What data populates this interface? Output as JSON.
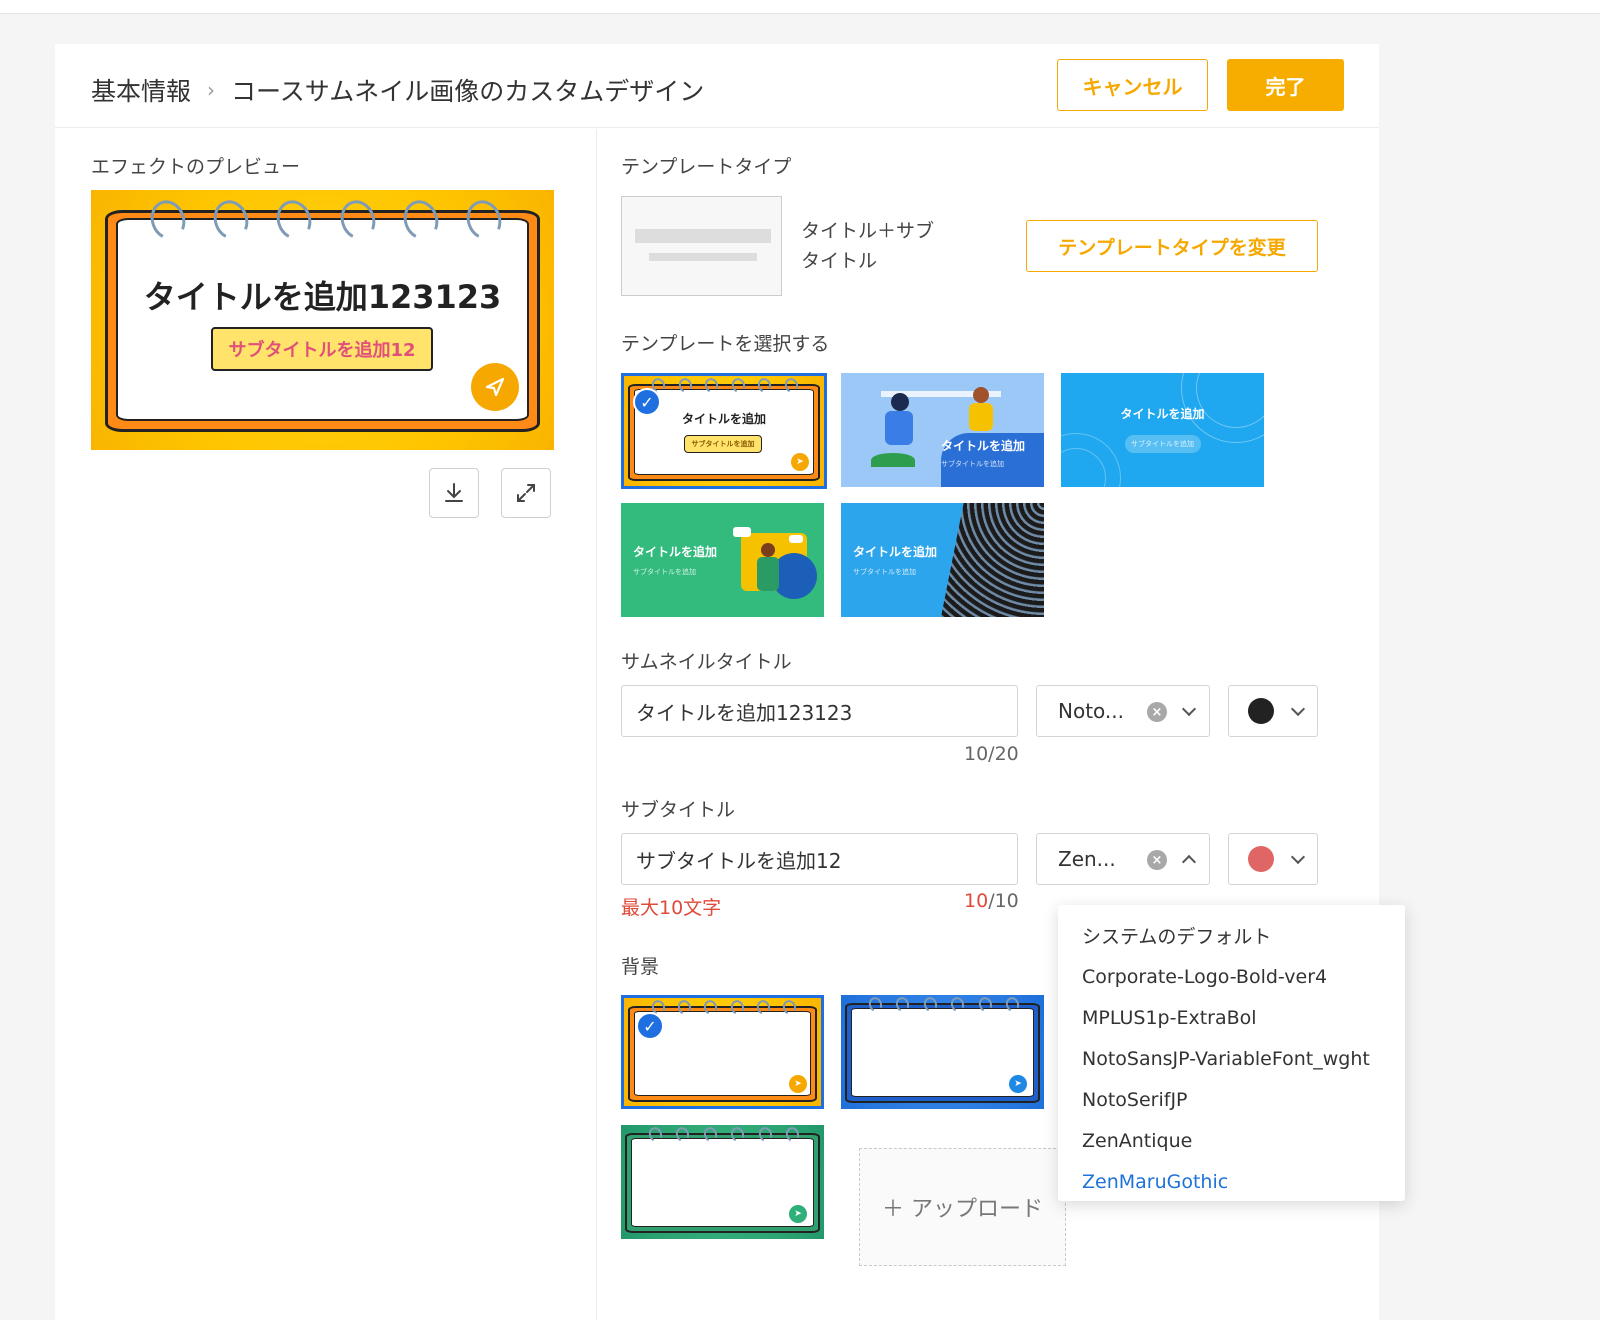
{
  "header": {
    "breadcrumb_root": "基本情報",
    "breadcrumb_separator": "›",
    "breadcrumb_current": "コースサムネイル画像のカスタムデザイン",
    "cancel_label": "キャンセル",
    "done_label": "完了"
  },
  "preview": {
    "section_label": "エフェクトのプレビュー",
    "title": "タイトルを追加123123",
    "subtitle": "サブタイトルを追加12",
    "download_icon": "download-icon",
    "expand_icon": "expand-icon"
  },
  "template_type": {
    "section_label": "テンプレートタイプ",
    "name_line1": "タイトル＋サブ",
    "name_line2": "タイトル",
    "change_label": "テンプレートタイプを変更"
  },
  "templates": {
    "section_label": "テンプレートを選択する",
    "items": [
      {
        "title": "タイトルを追加",
        "subtitle": "サブタイトルを追加",
        "style": "notebook-yellow",
        "selected": true
      },
      {
        "title": "タイトルを追加",
        "subtitle": "サブタイトルを追加",
        "style": "runners-blue",
        "selected": false
      },
      {
        "title": "タイトルを追加",
        "subtitle": "サブタイトルを追加",
        "style": "ripple-blue",
        "selected": false
      },
      {
        "title": "タイトルを追加",
        "subtitle": "サブタイトルを追加",
        "style": "people-green",
        "selected": false
      },
      {
        "title": "タイトルを追加",
        "subtitle": "サブタイトルを追加",
        "style": "building-blue",
        "selected": false
      }
    ]
  },
  "thumb_title": {
    "section_label": "サムネイルタイトル",
    "value": "タイトルを追加123123",
    "font": "Noto...",
    "color": "#222222",
    "counter": "10/20"
  },
  "subtitle": {
    "section_label": "サブタイトル",
    "value": "サブタイトルを追加12",
    "font": "Zen...",
    "color": "#e06666",
    "error": "最大10文字",
    "counter_current": "10",
    "counter_max": "/10"
  },
  "font_dropdown": {
    "options": [
      "システムのデフォルト",
      "Corporate-Logo-Bold-ver4",
      "MPLUS1p-ExtraBol",
      "NotoSansJP-VariableFont_wght",
      "NotoSerifJP",
      "ZenAntique",
      "ZenMaruGothic"
    ],
    "active_index": 6
  },
  "background": {
    "section_label": "背景",
    "items": [
      {
        "style": "notebook-yellow",
        "selected": true
      },
      {
        "style": "notebook-blue",
        "selected": false
      },
      {
        "style": "notebook-green",
        "selected": false
      }
    ],
    "upload_label": "＋ アップロード"
  },
  "colors": {
    "accent": "#f6a800",
    "selected_border": "#1f6fe0",
    "error": "#e04a3a",
    "link_active": "#1f72d8"
  }
}
